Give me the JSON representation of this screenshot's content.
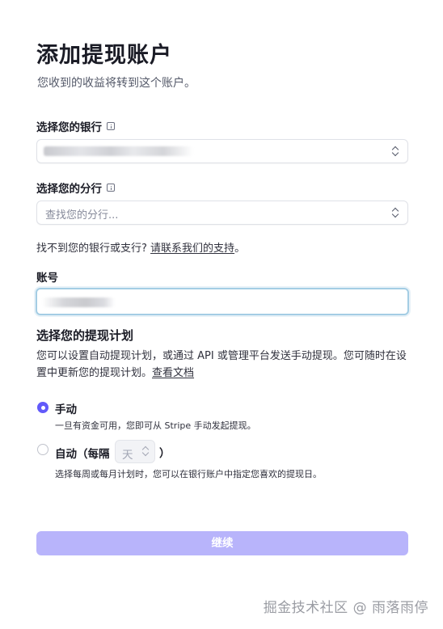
{
  "header": {
    "title": "添加提现账户",
    "subtitle": "您收到的收益将转到这个账户。"
  },
  "bank": {
    "label": "选择您的银行",
    "info_icon": "info-icon",
    "value_redacted": true
  },
  "branch": {
    "label": "选择您的分行",
    "info_icon": "info-icon",
    "placeholder": "查找您的分行..."
  },
  "help": {
    "text": "找不到您的银行或支行?",
    "link": "请联系我们的支持",
    "suffix": "。"
  },
  "account": {
    "label": "账号",
    "value_redacted": true
  },
  "schedule": {
    "title": "选择您的提现计划",
    "description": "您可以设置自动提现计划，或通过 API 或管理平台发送手动提现。您可随时在设置中更新您的提现计划。",
    "doc_link": "查看文档",
    "manual": {
      "label": "手动",
      "description": "一旦有资金可用，您即可从 Stripe 手动发起提现。",
      "checked": true
    },
    "automatic": {
      "label": "自动（每隔",
      "interval_value": "天",
      "label_suffix": "）",
      "description": "选择每周或每月计划时，您可以在银行账户中指定您喜欢的提现日。",
      "checked": false
    }
  },
  "footer": {
    "continue_label": "继续"
  },
  "watermark": {
    "text": "掘金技术社区 @ 雨落雨停"
  },
  "colors": {
    "accent": "#625afa",
    "button_disabled": "#b8b4fb",
    "focus_ring": "#a4cde4"
  }
}
